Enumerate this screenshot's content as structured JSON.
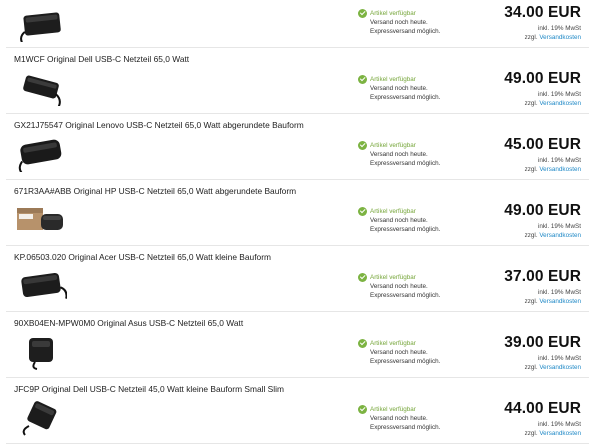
{
  "availability": {
    "status": "Artikel verfügbar",
    "line1": "Versand noch heute.",
    "line2": "Expressversand möglich."
  },
  "tax_note": "inkl. 19% MwSt",
  "shipping_prefix": "zzgl.",
  "shipping_link": "Versandkosten",
  "colors": {
    "accent_green": "#7cb342",
    "link_blue": "#1e88c6"
  },
  "products": [
    {
      "title": "",
      "price": "34.00 EUR",
      "image": "power-adapter-image"
    },
    {
      "title": "M1WCF Original Dell USB-C Netzteil 65,0 Watt",
      "price": "49.00 EUR",
      "image": "power-adapter-image"
    },
    {
      "title": "GX21J75547 Original Lenovo USB-C Netzteil 65,0 Watt abgerundete Bauform",
      "price": "45.00 EUR",
      "image": "power-adapter-image"
    },
    {
      "title": "671R3AA#ABB Original HP USB-C Netzteil 65,0 Watt abgerundete Bauform",
      "price": "49.00 EUR",
      "image": "power-adapter-box-image"
    },
    {
      "title": "KP.06503.020 Original Acer USB-C Netzteil 65,0 Watt kleine Bauform",
      "price": "37.00 EUR",
      "image": "power-adapter-image"
    },
    {
      "title": "90XB04EN-MPW0M0 Original Asus USB-C Netzteil 65,0 Watt",
      "price": "39.00 EUR",
      "image": "power-adapter-image"
    },
    {
      "title": "JFC9P Original Dell USB-C Netzteil 45,0 Watt kleine Bauform Small Slim",
      "price": "44.00 EUR",
      "image": "power-adapter-image"
    }
  ]
}
